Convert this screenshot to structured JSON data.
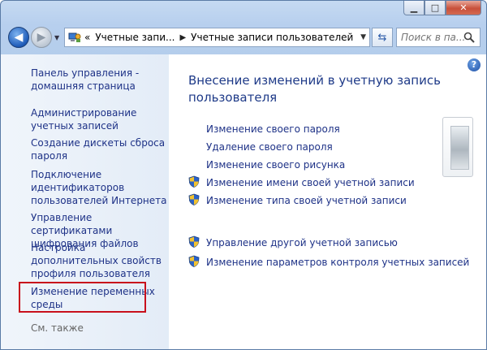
{
  "window": {
    "minimize_glyph": "▁",
    "maximize_glyph": "□",
    "close_glyph": "✕"
  },
  "nav": {
    "back_glyph": "◀",
    "forward_glyph": "▶",
    "history_glyph": "▼"
  },
  "address": {
    "prefix": "«",
    "crumbs": [
      "Учетные запи...",
      "Учетные записи пользователей"
    ],
    "separator": "▶",
    "dropdown_glyph": "▼"
  },
  "refresh_glyph": "⇆",
  "search": {
    "placeholder": "Поиск в пa..."
  },
  "sidebar": {
    "items": [
      {
        "label": "Панель управления - домашняя страница"
      },
      {
        "label": "Администрирование учетных записей"
      },
      {
        "label": "Создание дискеты сброса пароля"
      },
      {
        "label": "Подключение идентификаторов пользователей Интернета"
      },
      {
        "label": "Управление сертификатами шифрования файлов"
      },
      {
        "label": "Настройка дополнительных свойств профиля пользователя"
      },
      {
        "label": "Изменение переменных среды"
      }
    ],
    "see_also": "См. также"
  },
  "help_glyph": "?",
  "main": {
    "title": "Внесение изменений в учетную запись пользователя",
    "tasks": [
      {
        "label": "Изменение своего пароля"
      },
      {
        "label": "Удаление своего пароля"
      },
      {
        "label": "Изменение своего рисунка"
      },
      {
        "label": "Изменение имени своей учетной записи"
      },
      {
        "label": "Изменение типа своей учетной записи"
      }
    ],
    "other_tasks": [
      {
        "label": "Управление другой учетной записью"
      },
      {
        "label": "Изменение параметров контроля учетных записей"
      }
    ]
  },
  "colors": {
    "link": "#1e3287",
    "title": "#1e3a88",
    "highlight_border": "#c8101c",
    "window_frame": "#b7cfee"
  }
}
